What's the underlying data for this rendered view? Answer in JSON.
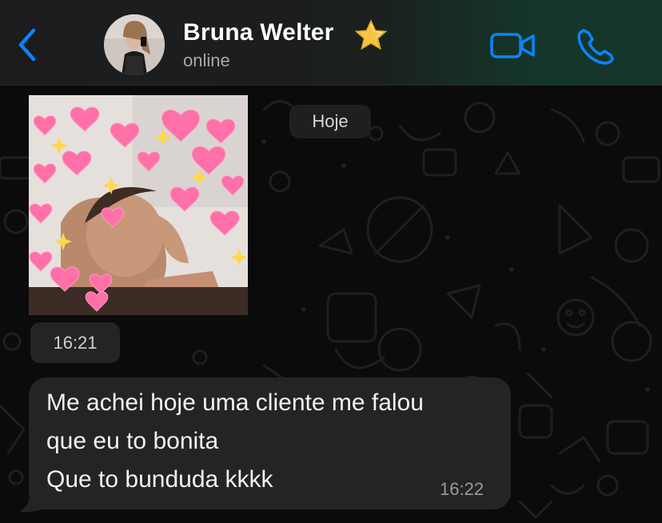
{
  "header": {
    "back_icon": "chevron-left-icon",
    "contact_name": "Bruna Welter",
    "name_emoji": "star-icon",
    "status": "online",
    "video_icon": "video-camera-icon",
    "call_icon": "phone-icon",
    "accent_color": "#0a84ff"
  },
  "chat": {
    "date_label": "Hoje",
    "messages": [
      {
        "type": "image",
        "time": "16:21"
      },
      {
        "type": "text",
        "lines": [
          "Me achei hoje uma cliente me falou",
          "que eu to bonita",
          "Que to bunduda kkkk"
        ],
        "time": "16:22"
      }
    ]
  }
}
